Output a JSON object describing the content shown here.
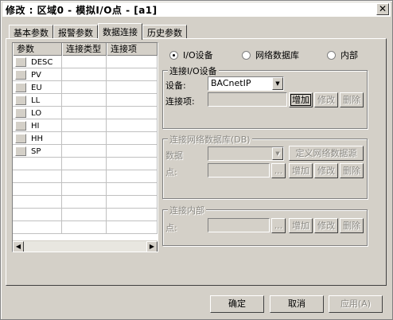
{
  "window": {
    "title": "修改 : 区域0 - 模拟I/O点 - [a1]",
    "close_glyph": "✕"
  },
  "tabs": [
    {
      "label": "基本参数",
      "active": false
    },
    {
      "label": "报警参数",
      "active": false
    },
    {
      "label": "数据连接",
      "active": true
    },
    {
      "label": "历史参数",
      "active": false
    }
  ],
  "grid": {
    "columns": [
      "参数",
      "连接类型",
      "连接项"
    ],
    "rows": [
      {
        "param": "DESC",
        "type": "",
        "item": ""
      },
      {
        "param": "PV",
        "type": "",
        "item": ""
      },
      {
        "param": "EU",
        "type": "",
        "item": ""
      },
      {
        "param": "LL",
        "type": "",
        "item": ""
      },
      {
        "param": "LO",
        "type": "",
        "item": ""
      },
      {
        "param": "HI",
        "type": "",
        "item": ""
      },
      {
        "param": "HH",
        "type": "",
        "item": ""
      },
      {
        "param": "SP",
        "type": "",
        "item": ""
      },
      {
        "param": "",
        "type": "",
        "item": ""
      },
      {
        "param": "",
        "type": "",
        "item": ""
      },
      {
        "param": "",
        "type": "",
        "item": ""
      },
      {
        "param": "",
        "type": "",
        "item": ""
      },
      {
        "param": "",
        "type": "",
        "item": ""
      },
      {
        "param": "",
        "type": "",
        "item": ""
      }
    ],
    "scroll_left_glyph": "◀",
    "scroll_right_glyph": "▶"
  },
  "connection_type": {
    "options": [
      "I/O设备",
      "网络数据库",
      "内部"
    ],
    "selected": "I/O设备"
  },
  "io_group": {
    "title": "连接I/O设备",
    "device_label": "设备:",
    "device_value": "BACnetIP",
    "item_label": "连接项:",
    "item_value": "",
    "add": "增加",
    "modify": "修改",
    "delete": "删除"
  },
  "db_group": {
    "title": "连接网络数据库(DB)",
    "data_label": "数据",
    "define_button": "定义网络数据源",
    "point_label": "点:",
    "browse": "...",
    "add": "增加",
    "modify": "修改",
    "delete": "删除"
  },
  "internal_group": {
    "title": "连接内部",
    "point_label": "点:",
    "browse": "...",
    "add": "增加",
    "modify": "修改",
    "delete": "删除"
  },
  "footer": {
    "ok": "确定",
    "cancel": "取消",
    "apply": "应用(A)"
  },
  "icons": {
    "dropdown": "chevron-down-icon"
  }
}
